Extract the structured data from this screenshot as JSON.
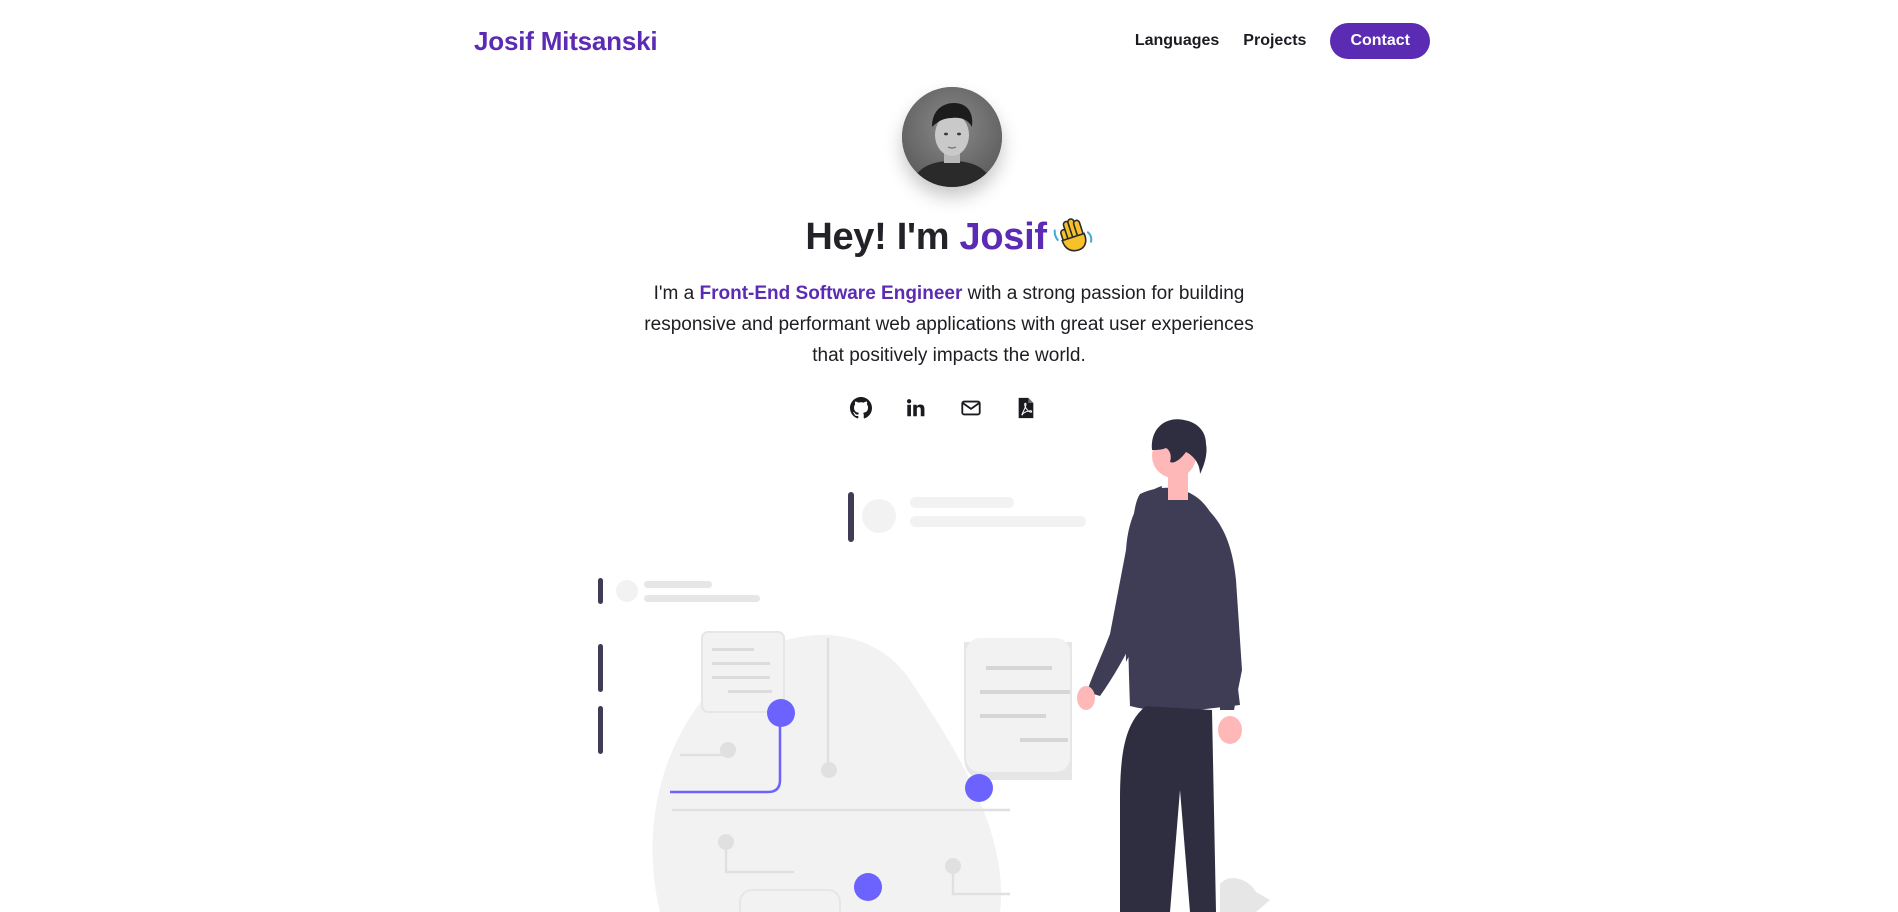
{
  "header": {
    "brand": "Josif Mitsanski",
    "nav": [
      {
        "label": "Languages"
      },
      {
        "label": "Projects"
      }
    ],
    "contact_label": "Contact"
  },
  "hero": {
    "greeting_prefix": "Hey! I'm ",
    "name": "Josif",
    "emoji": "waving-hand-icon",
    "desc_prefix": "I'm a ",
    "role": "Front-End Software Engineer",
    "desc_suffix": " with a strong passion for building responsive and performant web applications with great user experiences that positively impacts the world."
  },
  "socials": [
    {
      "icon": "github-icon"
    },
    {
      "icon": "linkedin-icon"
    },
    {
      "icon": "mail-icon"
    },
    {
      "icon": "pdf-file-icon"
    }
  ],
  "colors": {
    "accent": "#5b2bb3",
    "illustration_accent": "#6c63ff",
    "illustration_dark": "#3f3d56",
    "illustration_light": "#f2f2f2"
  }
}
